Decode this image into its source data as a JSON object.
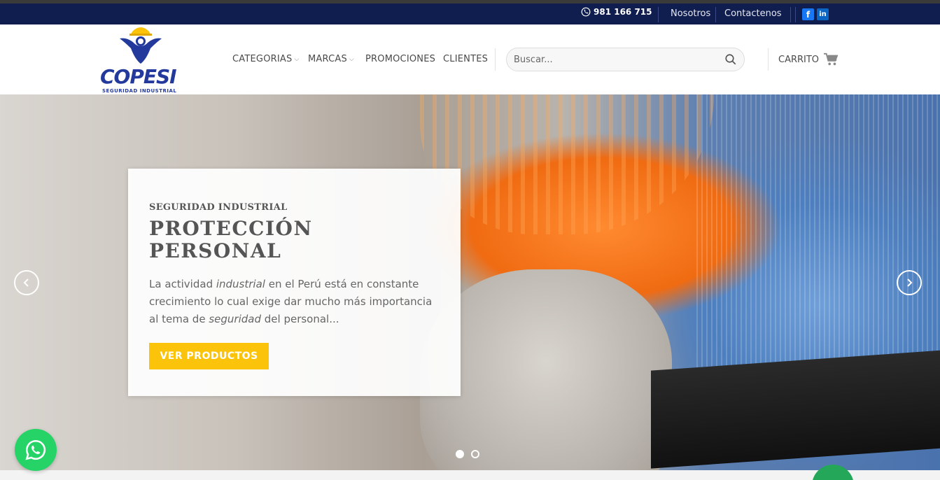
{
  "topbar": {
    "phone": "981 166 715",
    "links": [
      "Nosotros",
      "Contactenos"
    ],
    "social": [
      {
        "name": "facebook",
        "glyph": "f",
        "color": "#1877f2"
      },
      {
        "name": "linkedin",
        "glyph": "in",
        "color": "#0a66c2"
      }
    ]
  },
  "logo": {
    "wordmark": "COPESI",
    "tagline": "SEGURIDAD INDUSTRIAL"
  },
  "nav": {
    "items": [
      {
        "label": "CATEGORIAS",
        "has_dropdown": true
      },
      {
        "label": "MARCAS",
        "has_dropdown": true
      },
      {
        "label": "PROMOCIONES",
        "has_dropdown": false
      },
      {
        "label": "CLIENTES",
        "has_dropdown": false
      }
    ]
  },
  "search": {
    "placeholder": "Buscar...",
    "value": ""
  },
  "cart": {
    "label": "CARRITO"
  },
  "hero": {
    "kicker": "SEGURIDAD INDUSTRIAL",
    "title_line1": "PROTECCIÓN",
    "title_line2": "PERSONAL",
    "desc_part1": "La actividad ",
    "desc_em1": "industrial",
    "desc_part2": " en el Perú está en constante crecimiento lo cual exige dar mucho más importancia al tema de ",
    "desc_em2": "seguridad",
    "desc_part3": " del personal...",
    "button": "VER PRODUCTOS",
    "slides": 2,
    "active_slide": 1
  },
  "colors": {
    "topbar_bg": "#0f1d4f",
    "brand_blue": "#233a9c",
    "button_yellow": "#fbc40a",
    "whatsapp_green": "#25d366"
  }
}
